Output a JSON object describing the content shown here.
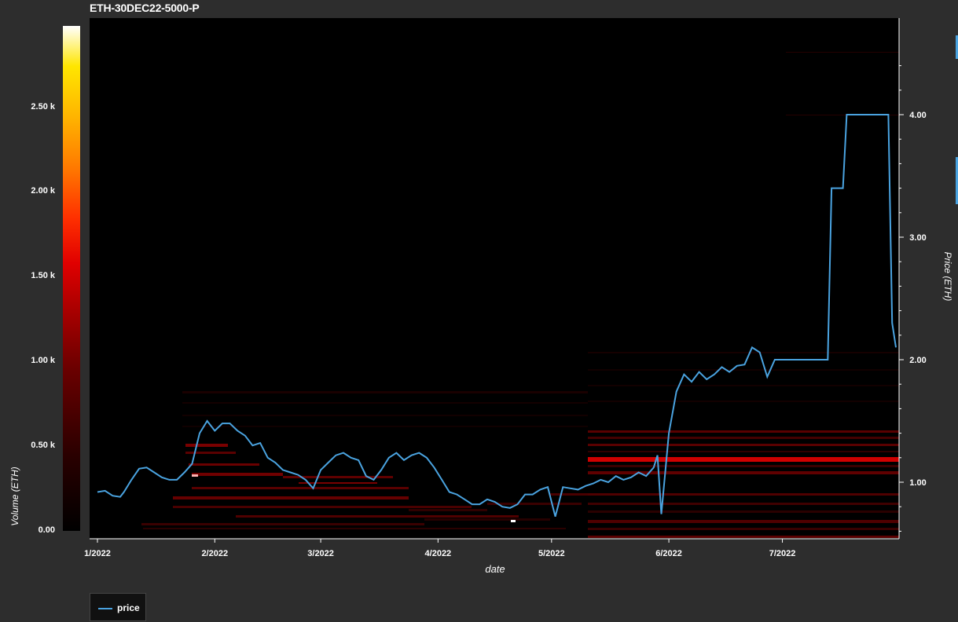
{
  "title": "ETH-30DEC22-5000-P",
  "colorbar": {
    "label": "Volume (ETH)",
    "ticks": [
      {
        "value": 0,
        "label": "0.00"
      },
      {
        "value": 500,
        "label": "0.50 k"
      },
      {
        "value": 1000,
        "label": "1.00 k"
      },
      {
        "value": 1500,
        "label": "1.50 k"
      },
      {
        "value": 2000,
        "label": "2.00 k"
      },
      {
        "value": 2500,
        "label": "2.50 k"
      }
    ],
    "range": [
      0,
      2980
    ]
  },
  "xaxis": {
    "label": "date",
    "ticks": [
      "1/2022",
      "2/2022",
      "3/2022",
      "4/2022",
      "5/2022",
      "6/2022",
      "7/2022"
    ]
  },
  "y2axis": {
    "label": "Price (ETH)",
    "ticks": [
      {
        "value": 1.0,
        "label": "1.00"
      },
      {
        "value": 2.0,
        "label": "2.00"
      },
      {
        "value": 3.0,
        "label": "3.00"
      },
      {
        "value": 4.0,
        "label": "4.00"
      }
    ]
  },
  "legend": {
    "items": [
      {
        "label": "price",
        "color": "#4aa3e0"
      }
    ]
  },
  "chart_data": {
    "type": "line",
    "title": "ETH-30DEC22-5000-P",
    "xlabel": "date",
    "ylabel": "Price (ETH)",
    "ylim": [
      0.5,
      4.8
    ],
    "x_start": "2022-01-01",
    "x_end": "2022-07-31",
    "series": [
      {
        "name": "price",
        "color": "#4aa3e0",
        "points": [
          [
            "2022-01-01",
            0.92
          ],
          [
            "2022-01-03",
            0.93
          ],
          [
            "2022-01-05",
            0.89
          ],
          [
            "2022-01-07",
            0.88
          ],
          [
            "2022-01-08",
            0.92
          ],
          [
            "2022-01-10",
            1.02
          ],
          [
            "2022-01-12",
            1.11
          ],
          [
            "2022-01-14",
            1.12
          ],
          [
            "2022-01-16",
            1.08
          ],
          [
            "2022-01-18",
            1.04
          ],
          [
            "2022-01-20",
            1.02
          ],
          [
            "2022-01-22",
            1.02
          ],
          [
            "2022-01-24",
            1.08
          ],
          [
            "2022-01-26",
            1.15
          ],
          [
            "2022-01-28",
            1.4
          ],
          [
            "2022-01-30",
            1.5
          ],
          [
            "2022-02-01",
            1.42
          ],
          [
            "2022-02-03",
            1.48
          ],
          [
            "2022-02-05",
            1.48
          ],
          [
            "2022-02-07",
            1.42
          ],
          [
            "2022-02-09",
            1.38
          ],
          [
            "2022-02-11",
            1.3
          ],
          [
            "2022-02-13",
            1.32
          ],
          [
            "2022-02-15",
            1.2
          ],
          [
            "2022-02-17",
            1.16
          ],
          [
            "2022-02-19",
            1.1
          ],
          [
            "2022-02-21",
            1.08
          ],
          [
            "2022-02-23",
            1.06
          ],
          [
            "2022-02-25",
            1.02
          ],
          [
            "2022-02-27",
            0.95
          ],
          [
            "2022-03-01",
            1.1
          ],
          [
            "2022-03-03",
            1.16
          ],
          [
            "2022-03-05",
            1.22
          ],
          [
            "2022-03-07",
            1.24
          ],
          [
            "2022-03-09",
            1.2
          ],
          [
            "2022-03-11",
            1.18
          ],
          [
            "2022-03-13",
            1.05
          ],
          [
            "2022-03-15",
            1.02
          ],
          [
            "2022-03-17",
            1.1
          ],
          [
            "2022-03-19",
            1.2
          ],
          [
            "2022-03-21",
            1.24
          ],
          [
            "2022-03-23",
            1.18
          ],
          [
            "2022-03-25",
            1.22
          ],
          [
            "2022-03-27",
            1.24
          ],
          [
            "2022-03-29",
            1.2
          ],
          [
            "2022-03-31",
            1.12
          ],
          [
            "2022-04-02",
            1.02
          ],
          [
            "2022-04-04",
            0.92
          ],
          [
            "2022-04-06",
            0.9
          ],
          [
            "2022-04-08",
            0.86
          ],
          [
            "2022-04-10",
            0.82
          ],
          [
            "2022-04-12",
            0.82
          ],
          [
            "2022-04-14",
            0.86
          ],
          [
            "2022-04-16",
            0.84
          ],
          [
            "2022-04-18",
            0.8
          ],
          [
            "2022-04-20",
            0.79
          ],
          [
            "2022-04-22",
            0.82
          ],
          [
            "2022-04-24",
            0.9
          ],
          [
            "2022-04-26",
            0.9
          ],
          [
            "2022-04-28",
            0.94
          ],
          [
            "2022-04-30",
            0.96
          ],
          [
            "2022-05-02",
            0.72
          ],
          [
            "2022-05-04",
            0.96
          ],
          [
            "2022-05-06",
            0.95
          ],
          [
            "2022-05-08",
            0.94
          ],
          [
            "2022-05-10",
            0.97
          ],
          [
            "2022-05-12",
            0.99
          ],
          [
            "2022-05-14",
            1.02
          ],
          [
            "2022-05-16",
            1.0
          ],
          [
            "2022-05-18",
            1.05
          ],
          [
            "2022-05-20",
            1.02
          ],
          [
            "2022-05-22",
            1.04
          ],
          [
            "2022-05-24",
            1.08
          ],
          [
            "2022-05-26",
            1.05
          ],
          [
            "2022-05-28",
            1.12
          ],
          [
            "2022-05-29",
            1.22
          ],
          [
            "2022-05-30",
            0.74
          ],
          [
            "2022-06-01",
            1.4
          ],
          [
            "2022-06-03",
            1.74
          ],
          [
            "2022-06-05",
            1.88
          ],
          [
            "2022-06-07",
            1.82
          ],
          [
            "2022-06-09",
            1.9
          ],
          [
            "2022-06-11",
            1.84
          ],
          [
            "2022-06-13",
            1.88
          ],
          [
            "2022-06-15",
            1.94
          ],
          [
            "2022-06-17",
            1.9
          ],
          [
            "2022-06-19",
            1.95
          ],
          [
            "2022-06-21",
            1.96
          ],
          [
            "2022-06-23",
            2.1
          ],
          [
            "2022-06-25",
            2.06
          ],
          [
            "2022-06-27",
            1.86
          ],
          [
            "2022-06-29",
            2.0
          ],
          [
            "2022-07-01",
            2.0
          ],
          [
            "2022-07-13",
            2.0
          ],
          [
            "2022-07-14",
            3.4
          ],
          [
            "2022-07-17",
            3.4
          ],
          [
            "2022-07-18",
            4.0
          ],
          [
            "2022-07-29",
            4.0
          ],
          [
            "2022-07-30",
            2.3
          ],
          [
            "2022-07-31",
            2.1
          ]
        ]
      }
    ]
  }
}
